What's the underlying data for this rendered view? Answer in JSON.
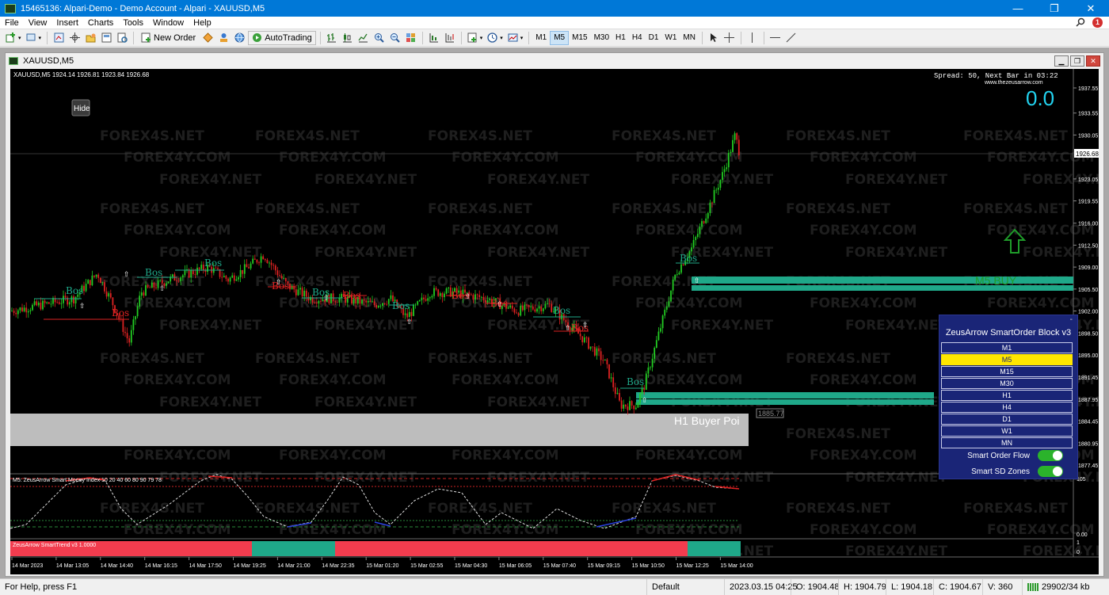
{
  "window": {
    "title": "15465136: Alpari-Demo - Demo Account - Alpari - XAUUSD,M5",
    "minimize": "—",
    "maximize": "❐",
    "close": "✕"
  },
  "menu": [
    "File",
    "View",
    "Insert",
    "Charts",
    "Tools",
    "Window",
    "Help"
  ],
  "menu_badge": "1",
  "toolbar": {
    "new_order": "New Order",
    "auto_trading": "AutoTrading",
    "timeframes": [
      "M1",
      "M5",
      "M15",
      "M30",
      "H1",
      "H4",
      "D1",
      "W1",
      "MN"
    ],
    "active_timeframe": "M5"
  },
  "chart_window": {
    "title": "XAUUSD,M5"
  },
  "chart": {
    "info": "XAUUSD,M5  1924.14 1926.81 1923.84 1926.68",
    "spread": "Spread: 50, Next Bar in 03:22",
    "site": "www.thezeusarrow.com",
    "counter": "0.0",
    "hide_button": "Hide",
    "current_price": "1926.68",
    "poi_label": "H1 Buyer Poi",
    "poi_price": "1885.77",
    "buy_signal": "M5 BUY",
    "bos_label": "Bos",
    "price_ticks": [
      "1937.55",
      "1933.55",
      "1930.05",
      "1926.68",
      "1923.05",
      "1919.55",
      "1916.00",
      "1912.50",
      "1909.00",
      "1905.50",
      "1902.00",
      "1898.50",
      "1895.00",
      "1891.45",
      "1887.95",
      "1884.45",
      "1880.95",
      "1877.45"
    ],
    "time_ticks": [
      "14 Mar 2023",
      "14 Mar 13:05",
      "14 Mar 14:40",
      "14 Mar 16:15",
      "14 Mar 17:50",
      "14 Mar 19:25",
      "14 Mar 21:00",
      "14 Mar 22:35",
      "15 Mar 01:20",
      "15 Mar 02:55",
      "15 Mar 04:30",
      "15 Mar 06:05",
      "15 Mar 07:40",
      "15 Mar 09:15",
      "15 Mar 10:50",
      "15 Mar 12:25",
      "15 Mar 14:00"
    ],
    "watermarks": [
      "FOREX4S.NET",
      "FOREX4Y.COM",
      "FOREX4Y.NET"
    ],
    "colors": {
      "bull": "#22cc22",
      "bear": "#dd2222",
      "zone": "#1fa889",
      "poi": "#bdbdbd"
    }
  },
  "indicator": {
    "label": "M5: ZeusArrow Smart Money Index  10 20 40 60 80 90 79 78",
    "ticks": [
      "105",
      "0.00"
    ]
  },
  "trend": {
    "label": "ZeusArrow SmartTrend v3 1.0000",
    "ticks": [
      "1",
      "0"
    ]
  },
  "panel": {
    "title": "ZeusArrow SmartOrder Block v3",
    "timeframes": [
      "M1",
      "M5",
      "M15",
      "M30",
      "H1",
      "H4",
      "D1",
      "W1",
      "MN"
    ],
    "selected": "M5",
    "toggle1": "Smart Order Flow",
    "toggle2": "Smart SD Zones",
    "dash": "-"
  },
  "status": {
    "help": "For Help, press F1",
    "profile": "Default",
    "time": "2023.03.15 04:25",
    "open": "O: 1904.48",
    "high": "H: 1904.79",
    "low": "L: 1904.18",
    "close": "C: 1904.67",
    "volume": "V: 360",
    "connection": "29902/34 kb"
  }
}
